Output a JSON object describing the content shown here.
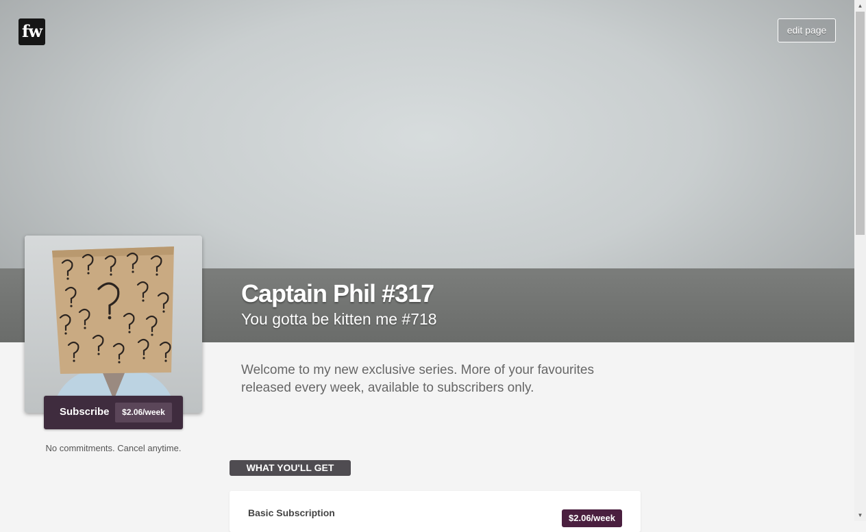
{
  "header": {
    "logo_text": "fw",
    "edit_label": "edit page"
  },
  "profile": {
    "title": "Captain Phil #317",
    "subtitle": "You gotta be kitten me #718",
    "description": "Welcome to my new exclusive series. More of your favourites released every week, available to subscribers only."
  },
  "subscribe": {
    "label": "Subscribe",
    "price": "$2.06/week",
    "note": "No commitments. Cancel anytime."
  },
  "section": {
    "heading": "WHAT YOU'LL GET"
  },
  "tiers": [
    {
      "name": "Basic Subscription",
      "price": "$2.06/week"
    }
  ],
  "scrollbar": {
    "up_icon": "▲",
    "down_icon": "▼"
  },
  "colors": {
    "subscribe_button": "#3f2c3e",
    "tier_price_badge": "#4a1f3f",
    "section_tag": "#4f4c51"
  }
}
